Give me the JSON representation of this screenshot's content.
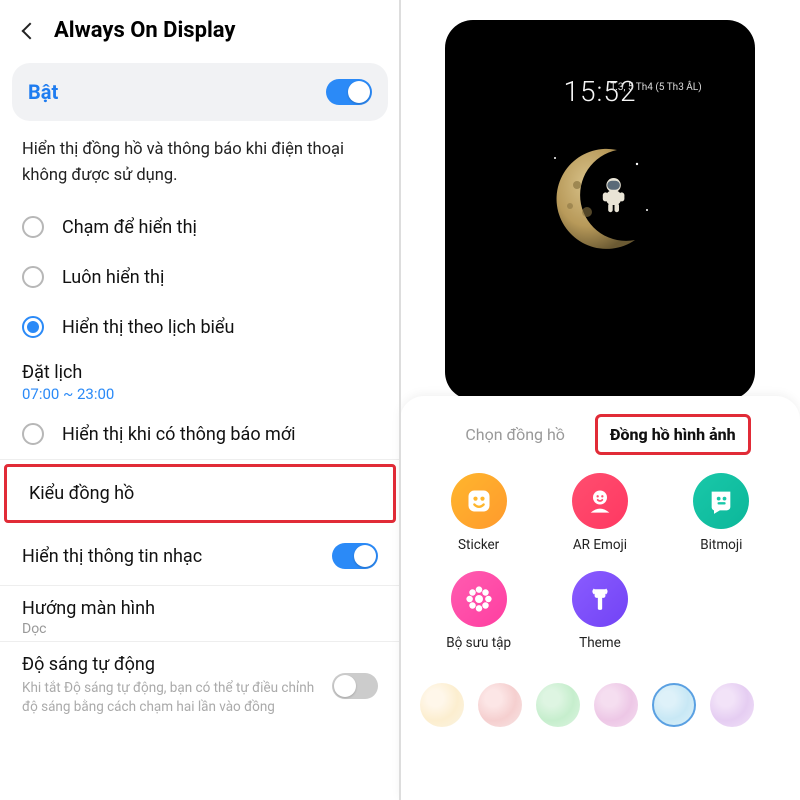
{
  "header": {
    "title": "Always On Display"
  },
  "enable": {
    "label": "Bật",
    "on": true
  },
  "description": "Hiển thị đồng hồ và thông báo khi điện thoại không được sử dụng.",
  "radios": [
    {
      "label": "Chạm để hiển thị",
      "selected": false
    },
    {
      "label": "Luôn hiển thị",
      "selected": false
    },
    {
      "label": "Hiển thị theo lịch biểu",
      "selected": true
    }
  ],
  "schedule": {
    "title": "Đặt lịch",
    "time": "07:00 ~ 23:00"
  },
  "new_notif": {
    "label": "Hiển thị khi có thông báo mới",
    "selected": false
  },
  "clock_style": {
    "label": "Kiểu đồng hồ"
  },
  "music_info": {
    "label": "Hiển thị thông tin nhạc",
    "on": true
  },
  "orientation": {
    "title": "Hướng màn hình",
    "value": "Dọc"
  },
  "auto_brightness": {
    "title": "Độ sáng tự động",
    "desc": "Khi tắt Độ sáng tự động, bạn có thể tự điều chỉnh độ sáng bằng cách chạm hai lần vào đồng",
    "on": false
  },
  "preview": {
    "time": "15:52",
    "date": "T.3, 5 Th4 (5 Th3 ÂL)"
  },
  "tabs": {
    "inactive": "Chọn đồng hồ",
    "active": "Đồng hồ hình ảnh"
  },
  "categories": [
    {
      "label": "Sticker",
      "color": "yellow"
    },
    {
      "label": "AR Emoji",
      "color": "red"
    },
    {
      "label": "Bitmoji",
      "color": "teal"
    },
    {
      "label": "Bộ sưu tập",
      "color": "pink"
    },
    {
      "label": "Theme",
      "color": "purple"
    }
  ]
}
